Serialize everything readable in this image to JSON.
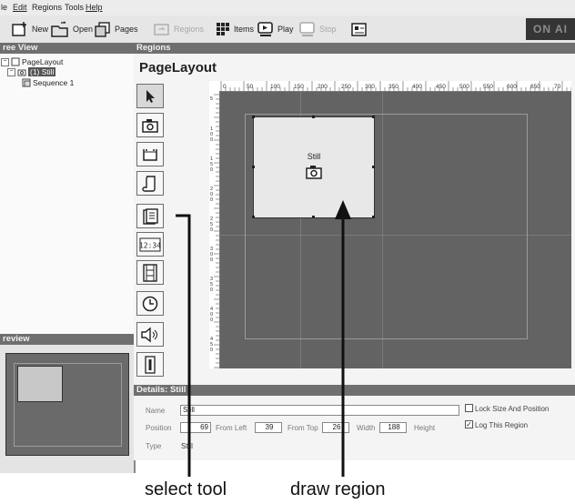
{
  "menu": [
    "le",
    "Edit",
    "Regions",
    "Tools",
    "Help"
  ],
  "toolbar": {
    "new": "New",
    "open": "Open",
    "pages": "Pages",
    "regions": "Regions",
    "items": "Items",
    "play": "Play",
    "stop": "Stop",
    "on_air": "ON AI"
  },
  "tree_view": {
    "header": "ree View",
    "items": [
      "PageLayout",
      "(1) Still",
      "Sequence 1"
    ]
  },
  "preview": {
    "header": "review"
  },
  "regions": {
    "header": "Regions",
    "page_title": "PageLayout",
    "ruler_labels": [
      "0",
      "50",
      "100",
      "150",
      "200",
      "250",
      "300",
      "350",
      "400",
      "450",
      "500",
      "550",
      "600",
      "650",
      "70"
    ],
    "vruler_labels": [
      "5",
      "1 0 0",
      "1 5 0",
      "2 0 0",
      "2 5 0",
      "3 0 0",
      "3 5 0",
      "4 0 0",
      "4 5 0"
    ],
    "region_label": "Still",
    "tools": [
      "select-arrow",
      "camera",
      "ticker",
      "scroll",
      "list",
      "clock-digital",
      "film",
      "clock",
      "speaker",
      "thermometer"
    ]
  },
  "details": {
    "header": "Details: Still",
    "name_label": "Name",
    "name_value": "Still",
    "position_label": "Position",
    "position_value": "69",
    "from_left_label": "From Left",
    "from_left_value": "39",
    "from_top_label": "From Top",
    "from_top_value": "26",
    "width_label": "Width",
    "width_value": "188",
    "height_label": "Height",
    "type_label": "Type",
    "type_value": "Still",
    "lock_label": "Lock Size And Position",
    "lock_checked": false,
    "log_label": "Log This Region",
    "log_checked": true
  },
  "callouts": {
    "select_tool": "select tool",
    "draw_region": "draw region"
  }
}
